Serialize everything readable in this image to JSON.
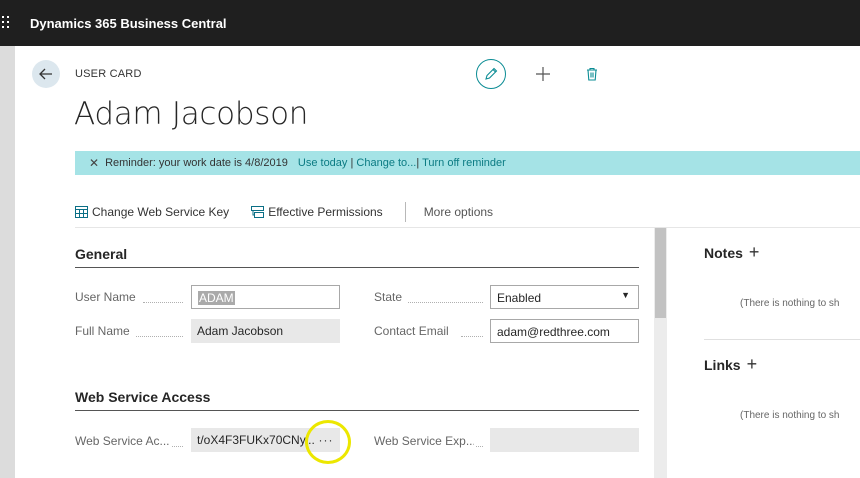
{
  "app": {
    "title": "Dynamics 365 Business Central"
  },
  "page": {
    "label": "USER CARD",
    "title": "Adam Jacobson"
  },
  "reminder": {
    "message": "Reminder: your work date is 4/8/2019",
    "use_today": "Use today",
    "change_to": "Change to...",
    "turn_off": "Turn off reminder",
    "separator": "|"
  },
  "actions": {
    "change_key": "Change Web Service Key",
    "effective_permissions": "Effective Permissions",
    "more_options": "More options"
  },
  "general": {
    "title": "General",
    "user_name_label": "User Name",
    "user_name_value": "ADAM",
    "full_name_label": "Full Name",
    "full_name_value": "Adam Jacobson",
    "state_label": "State",
    "state_value": "Enabled",
    "contact_email_label": "Contact Email",
    "contact_email_value": "adam@redthree.com"
  },
  "web_service": {
    "title": "Web Service Access",
    "key_label": "Web Service Ac...",
    "key_value": "t/oX4F3FUKx70CNy...",
    "key_lookup": "···",
    "expiry_label": "Web Service Exp...",
    "expiry_value": ""
  },
  "factbox": {
    "notes_title": "Notes",
    "notes_empty": "(There is nothing to sh",
    "links_title": "Links",
    "links_empty": "(There is nothing to sh"
  },
  "colors": {
    "topbar": "#1f1f1f",
    "accent": "#0b8c94",
    "reminder_bg": "#a5e3e6",
    "highlight": "#ece700"
  },
  "icons": {
    "back": "arrow-left-icon",
    "edit": "pencil-icon",
    "new": "plus-icon",
    "delete": "trash-icon",
    "change_key": "key-table-icon",
    "effective_permissions": "permissions-icon",
    "close": "close-icon",
    "dropdown": "caret-down-icon"
  }
}
